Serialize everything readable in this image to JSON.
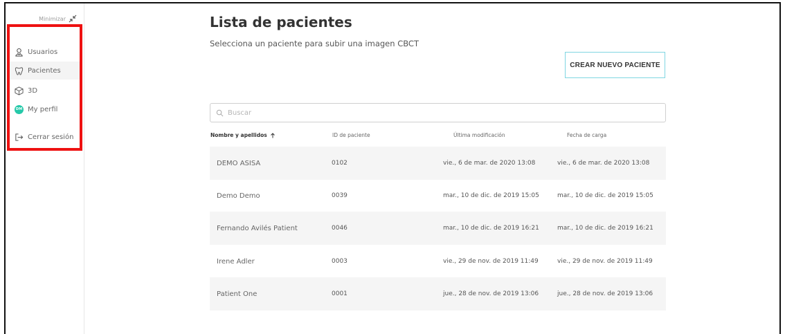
{
  "sidebar": {
    "minimize_label": "Minimizar",
    "items": [
      {
        "label": "Usuarios",
        "icon": "user-icon"
      },
      {
        "label": "Pacientes",
        "icon": "tooth-icon",
        "active": true
      },
      {
        "label": "3D",
        "icon": "cube-icon"
      },
      {
        "label": "My perfil",
        "icon": "avatar",
        "avatar_initials": "DM"
      },
      {
        "label": "Cerrar sesión",
        "icon": "logout-icon"
      }
    ]
  },
  "colors": {
    "accent": "#25c9a9",
    "highlight": "#ee1111",
    "button_border": "#7fd6e2"
  },
  "main": {
    "title": "Lista de pacientes",
    "subtitle": "Selecciona un paciente para subir una imagen CBCT",
    "create_button": "CREAR NUEVO PACIENTE",
    "search_placeholder": "Buscar"
  },
  "table": {
    "headers": {
      "name": "Nombre y apellidos",
      "id": "ID de paciente",
      "modified": "Última modificación",
      "uploaded": "Fecha de carga"
    },
    "rows": [
      {
        "name": "DEMO ASISA",
        "id": "0102",
        "modified": "vie., 6 de mar. de 2020 13:08",
        "uploaded": "vie., 6 de mar. de 2020 13:08"
      },
      {
        "name": "Demo Demo",
        "id": "0039",
        "modified": "mar., 10 de dic. de 2019 15:05",
        "uploaded": "mar., 10 de dic. de 2019 15:05"
      },
      {
        "name": "Fernando Avilés Patient",
        "id": "0046",
        "modified": "mar., 10 de dic. de 2019 16:21",
        "uploaded": "mar., 10 de dic. de 2019 16:21"
      },
      {
        "name": "Irene Adler",
        "id": "0003",
        "modified": "vie., 29 de nov. de 2019 11:49",
        "uploaded": "vie., 29 de nov. de 2019 11:49"
      },
      {
        "name": "Patient One",
        "id": "0001",
        "modified": "jue., 28 de nov. de 2019 13:06",
        "uploaded": "jue., 28 de nov. de 2019 13:06"
      }
    ]
  }
}
